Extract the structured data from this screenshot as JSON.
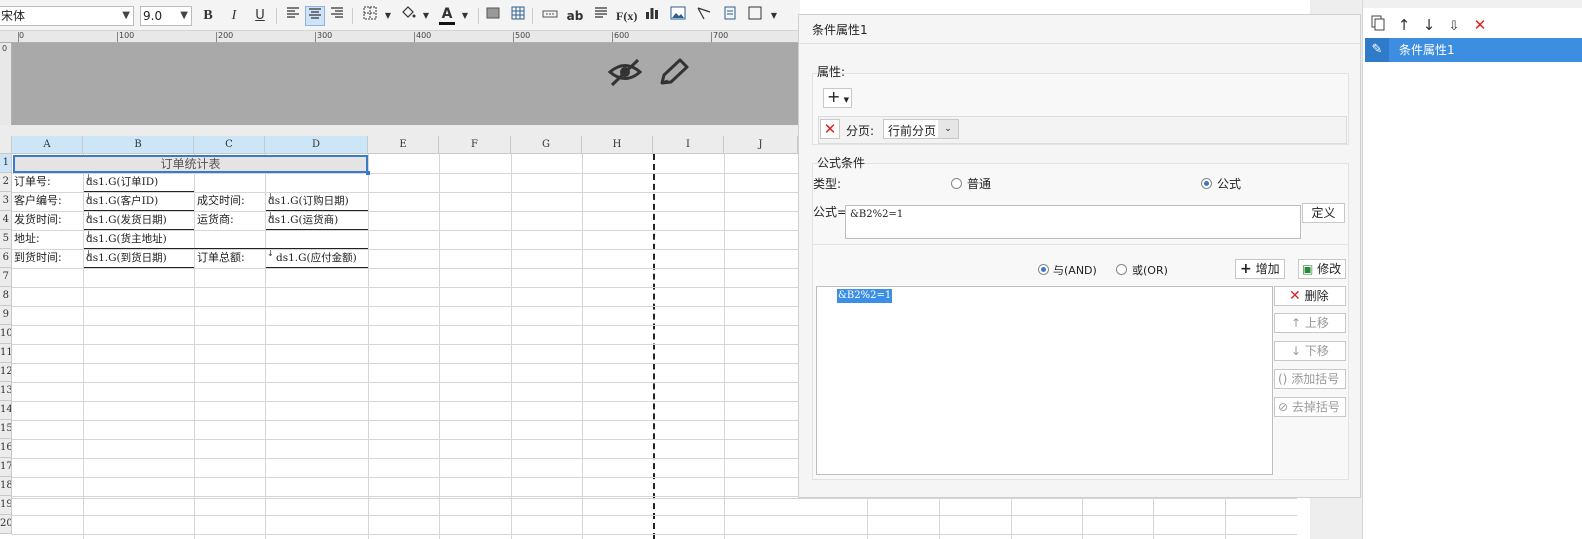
{
  "toolbar": {
    "font_name": "宋体",
    "font_size": "9.0",
    "bold_label": "B",
    "italic_label": "I",
    "underline_label": "U",
    "abc_label": "ab",
    "fx_label": "F(x)",
    "font_color_label": "A"
  },
  "ruler": {
    "ticks": [
      "0",
      "100",
      "200",
      "300",
      "400",
      "500",
      "600",
      "700"
    ],
    "v_ticks": [
      "0"
    ]
  },
  "grid": {
    "columns": [
      "A",
      "B",
      "C",
      "D",
      "E",
      "F",
      "G",
      "H",
      "I",
      "J"
    ],
    "rows": [
      "1",
      "2",
      "3",
      "4",
      "5",
      "6",
      "7",
      "8",
      "9",
      "10",
      "11",
      "12",
      "13",
      "14",
      "15",
      "16",
      "17",
      "18",
      "19",
      "20"
    ],
    "title": "订单统计表",
    "cells": {
      "a2": "订单号:",
      "b2": "ds1.G(订单ID)",
      "a3": "客户编号:",
      "b3": "ds1.G(客户ID)",
      "c3": "成交时间:",
      "d3": "ds1.G(订购日期)",
      "a4": "发货时间:",
      "b4": "ds1.G(发货日期)",
      "c4": "运货商:",
      "d4": "ds1.G(运货商)",
      "a5": "地址:",
      "b5": "ds1.G(货主地址)",
      "a6": "到货时间:",
      "b6": "ds1.G(到货日期)",
      "c6": "订单总额:",
      "d6": "ds1.G(应付金额)"
    }
  },
  "dialog": {
    "title": "条件属性1",
    "attributes": {
      "label": "属性:",
      "add_label": "+",
      "paging_label": "分页:",
      "paging_value": "行前分页"
    },
    "formula_condition": {
      "label": "公式条件",
      "type_label": "类型:",
      "type_normal": "普通",
      "type_formula": "公式",
      "selected_type": "公式",
      "formula_label": "公式=",
      "formula_value": "&B2%2=1",
      "define_label": "定义",
      "and_label": "与(AND)",
      "or_label": "或(OR)",
      "add_label": "增加",
      "modify_label": "修改",
      "list_items": [
        "&B2%2=1"
      ],
      "delete_label": "删除",
      "up_label": "上移",
      "down_label": "下移",
      "add_bracket_label": "添加括号",
      "remove_bracket_label": "去掉括号"
    }
  },
  "right_panel": {
    "selected_item": "条件属性1"
  },
  "colors": {
    "accent": "#3d8ee0",
    "danger": "#e02020",
    "header_band": "#a9a9a9",
    "selected_header": "#cde6f7"
  }
}
